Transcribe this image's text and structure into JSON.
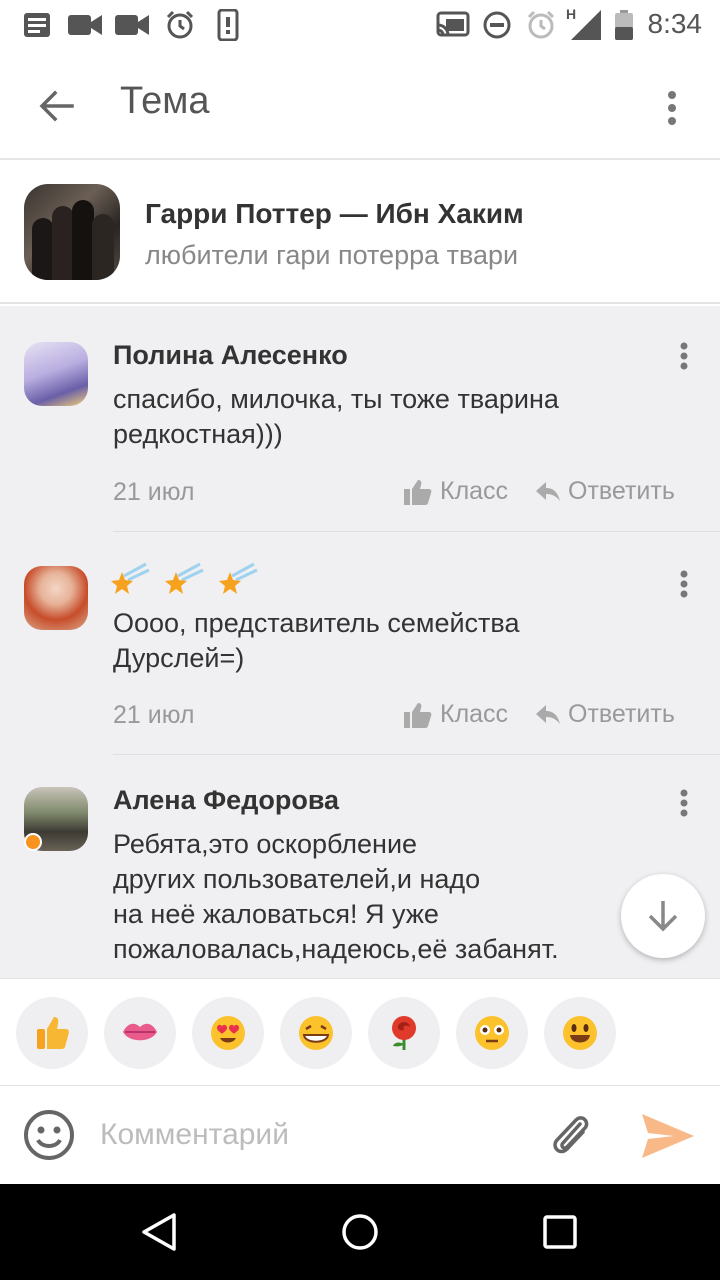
{
  "status_bar": {
    "time": "8:34",
    "network_label": "H",
    "icons": [
      "notes-icon",
      "video-icon",
      "video-icon",
      "alarm-icon",
      "phone-vibrate-icon",
      "cast-icon",
      "do-not-disturb-icon",
      "alarm-icon",
      "signal-icon",
      "battery-icon"
    ]
  },
  "app_bar": {
    "title": "Тема",
    "back_icon": "arrow-left-icon",
    "menu_icon": "more-vert-icon"
  },
  "group": {
    "name": "Гарри Поттер — Ибн Хаким",
    "subtitle": "любители гари потерра твари"
  },
  "comments": [
    {
      "author": "Полина Алесенко",
      "text_lines": [
        "спасибо, милочка, ты тоже тварина",
        "редкостная)))"
      ],
      "date": "21 июл",
      "like_label": "Класс",
      "reply_label": "Ответить"
    },
    {
      "author": "",
      "author_decoration": "three-shooting-star-icons",
      "text_lines": [
        "Оооо, представитель семейства",
        "Дурслей=)"
      ],
      "date": "21 июл",
      "like_label": "Класс",
      "reply_label": "Ответить"
    },
    {
      "author": "Алена Федорова",
      "online": true,
      "text_lines": [
        "Ребята,это оскорбление",
        "других пользователей,и надо",
        "на неё жаловаться! Я уже",
        "пожаловалась,надеюсь,её забанят."
      ]
    }
  ],
  "emoji_bar": {
    "emojis": [
      "👍",
      "💋",
      "😍",
      "😁",
      "🌹",
      "😳",
      "😃"
    ]
  },
  "composer": {
    "placeholder": "Комментарий",
    "value": ""
  },
  "colors": {
    "accent": "#f7931e",
    "feed_bg": "#f0eff2",
    "muted_text": "#999999",
    "send_arrow": "#f9b887"
  }
}
